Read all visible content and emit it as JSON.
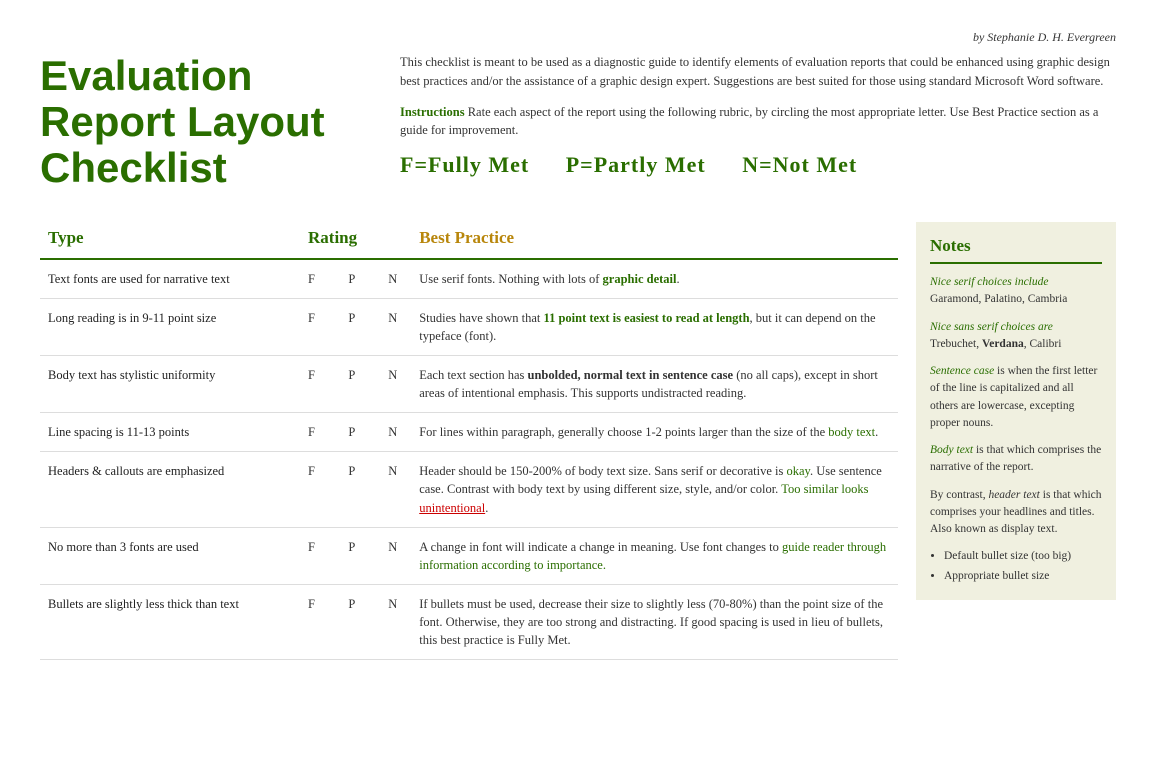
{
  "byline": "by Stephanie D. H. Evergreen",
  "title": "Evaluation Report Layout Checklist",
  "intro": {
    "paragraph1": "This checklist is meant to be used as a diagnostic guide to identify elements of evaluation reports that could be enhanced using graphic design best practices and/or the assistance of a graphic design expert. Suggestions are best suited for those using standard Microsoft Word software.",
    "instructions_label": "Instructions",
    "instructions_text": "Rate each aspect of the report using the following rubric, by circling the most appropriate letter. Use Best Practice section as a guide for improvement.",
    "rubric": "F=Fully Met     P=Partly Met     N=Not Met"
  },
  "table": {
    "headers": {
      "type": "Type",
      "rating": "Rating",
      "bestpractice": "Best Practice",
      "notes": "Notes"
    },
    "rows": [
      {
        "type": "Text fonts are used for narrative text",
        "rating": "F   P   N",
        "bestpractice": "Use serif fonts. Nothing with lots of graphic detail."
      },
      {
        "type": "Long reading is in 9-11 point size",
        "rating": "F   P   N",
        "bestpractice": "Studies have shown that 11 point text is easiest to read at length, but it can depend on the typeface (font)."
      },
      {
        "type": "Body text has stylistic uniformity",
        "rating": "F   P   N",
        "bestpractice": "Each text section has unbolded, normal text in sentence case (no all caps), except in short areas of intentional emphasis. This supports undistracted reading."
      },
      {
        "type": "Line spacing is 11-13 points",
        "rating": "F   P   N",
        "bestpractice": "For lines within paragraph, generally choose 1-2 points larger than the size of the body text."
      },
      {
        "type": "Headers & callouts are emphasized",
        "rating": "F   P   N",
        "bestpractice": "Header should be 150-200% of body text size. Sans serif or decorative is okay. Use sentence case. Contrast with body text by using different size, style, and/or color. Too similar looks unintentional."
      },
      {
        "type": "No more than 3 fonts are used",
        "rating": "F   P   N",
        "bestpractice": "A change in font will indicate a change in meaning. Use font changes to guide reader through information according to importance."
      },
      {
        "type": "Bullets are slightly less thick than text",
        "rating": "F   P   N",
        "bestpractice": "If bullets must be used, decrease their size to slightly less (70-80%) than the point size of the font. Otherwise, they are too strong and distracting. If good spacing is used in lieu of bullets, this best practice is Fully Met."
      }
    ]
  },
  "notes": {
    "title": "Notes",
    "items": [
      {
        "italic_label": "Nice serif choices include",
        "text": "Garamond, Palatino, Cambria"
      },
      {
        "italic_label": "Nice sans serif choices are",
        "text": "Trebuchet, Verdana, Calibri"
      },
      {
        "italic_label": "Sentence case",
        "text": " is when the first letter of the line is capitalized and all others are lowercase, excepting proper nouns."
      },
      {
        "italic_label": "Body text",
        "text": " is that which comprises the narrative of the report."
      },
      {
        "text": "By contrast, ",
        "italic_label": "header text",
        "text2": " is that which comprises your headlines and titles. Also known as display text."
      },
      {
        "bullets": [
          "Default bullet size (too big)",
          "Appropriate bullet size"
        ]
      }
    ]
  }
}
